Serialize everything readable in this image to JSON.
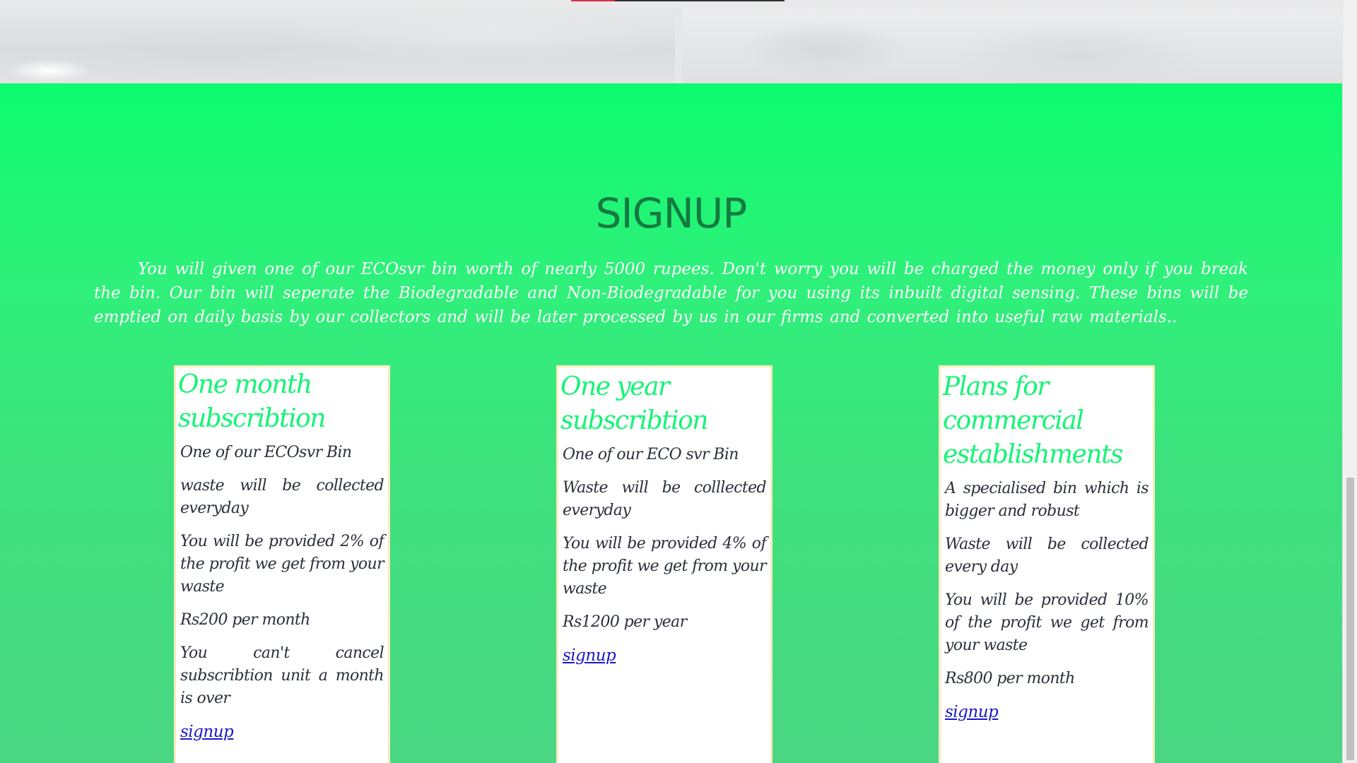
{
  "signup": {
    "title": "SIGNUP",
    "description": "You will given one of our ECOsvr bin worth of nearly 5000 rupees. Don't worry you will be charged the money only if you break the bin. Our bin will seperate the Biodegradable and Non-Biodegradable for you using its inbuilt digital sensing. These bins will be emptied on daily basis by our collectors and will be later processed by us in our firms and converted into useful raw materials.."
  },
  "plans": [
    {
      "title": "One month subscribtion",
      "features": [
        "One of our ECOsvr Bin",
        "waste will be collected everyday",
        "You will be provided 2% of the profit we get from your waste",
        "Rs200 per month",
        "You can't cancel subscribtion unit a month is over"
      ],
      "link": "signup"
    },
    {
      "title": "One year subscribtion",
      "features": [
        "One of our ECO svr Bin",
        "Waste will be colllected everyday",
        "You will be provided 4% of the profit we get from your waste",
        "Rs1200 per year"
      ],
      "link": "signup"
    },
    {
      "title": "Plans for commercial establishments",
      "features": [
        "A specialised bin which is bigger and robust",
        "Waste will be collected every day",
        "You will be provided 10% of the profit we get from your waste",
        "Rs800 per month"
      ],
      "link": "signup"
    }
  ],
  "colors": {
    "section_gradient_top": "#0dfb6f",
    "section_gradient_bottom": "#4ad682",
    "title_color": "#137a40",
    "plan_title_color": "#12f573",
    "link_color": "#1a17c9",
    "card_border": "#fbeac0"
  }
}
